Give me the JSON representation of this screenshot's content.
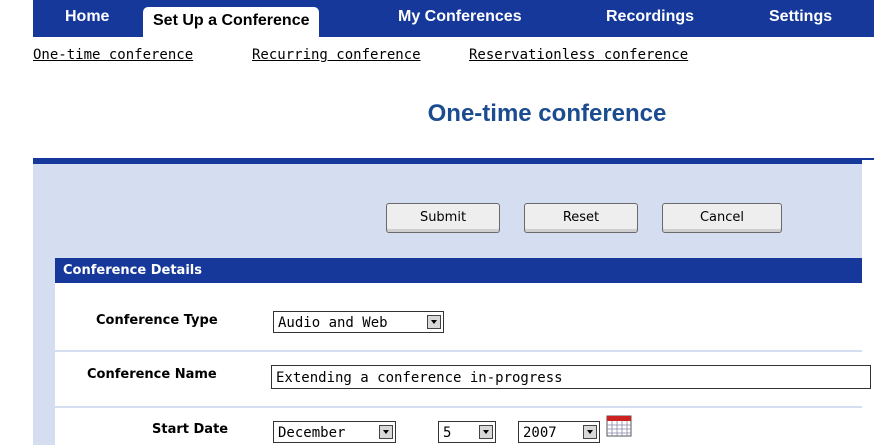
{
  "nav": {
    "tabs": [
      {
        "label": "Home"
      },
      {
        "label": "Set Up a Conference"
      },
      {
        "label": "My Conferences"
      },
      {
        "label": "Recordings"
      },
      {
        "label": "Settings"
      }
    ]
  },
  "subnav": {
    "links": [
      {
        "label": "One-time conference"
      },
      {
        "label": "Recurring conference"
      },
      {
        "label": "Reservationless conference"
      }
    ]
  },
  "page": {
    "title": "One-time conference"
  },
  "buttons": {
    "submit": "Submit",
    "reset": "Reset",
    "cancel": "Cancel"
  },
  "section": {
    "title": "Conference Details"
  },
  "form": {
    "conference_type": {
      "label": "Conference Type",
      "value": "Audio and Web"
    },
    "conference_name": {
      "label": "Conference Name",
      "value": "Extending a conference in-progress"
    },
    "start_date": {
      "label": "Start Date",
      "month": "December",
      "day": "5",
      "year": "2007"
    }
  },
  "colors": {
    "nav_blue": "#15389a",
    "panel_bg": "#d4def0",
    "title_blue": "#1a4c8f",
    "calendar_red": "#cc2222"
  }
}
